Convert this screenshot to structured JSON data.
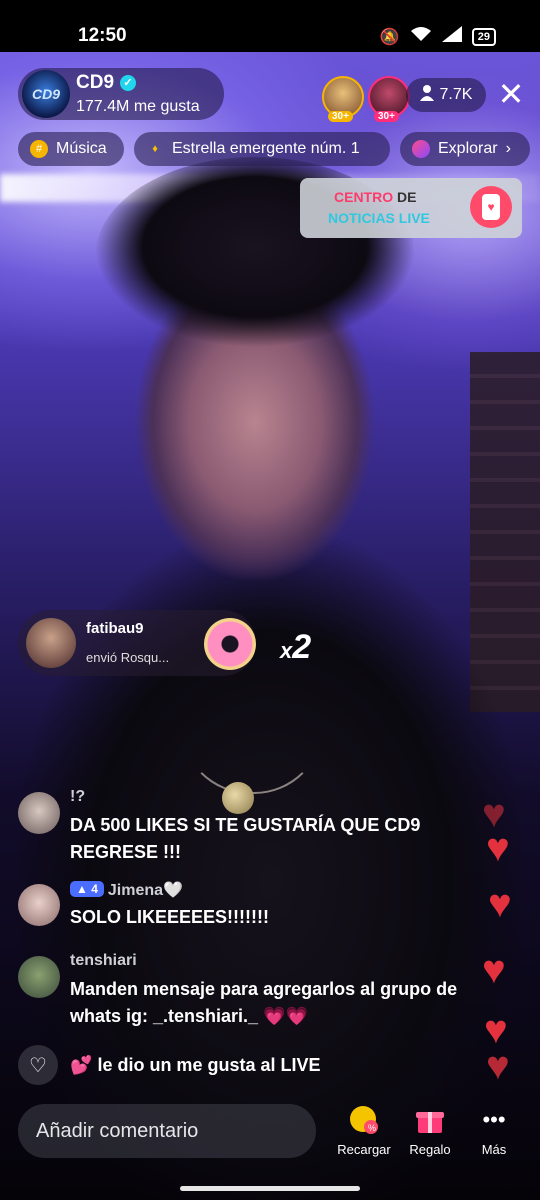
{
  "status_bar": {
    "time": "12:50",
    "battery": "29"
  },
  "host": {
    "name": "CD9",
    "logo_text": "CD9",
    "likes": "177.4M me gusta"
  },
  "top_viewers": [
    {
      "badge": "30+"
    },
    {
      "badge": "30+"
    }
  ],
  "viewer_count": "7.7K",
  "chips": [
    {
      "label": "Música",
      "icon": "music-icon"
    },
    {
      "label": "Estrella emergente núm. 1",
      "icon": "flame-icon"
    },
    {
      "label": "Explorar",
      "icon": "planet-icon"
    }
  ],
  "news_banner": {
    "line1_pink": "CENTRO",
    "line1_rest": " DE",
    "line2": "NOTICIAS LIVE"
  },
  "gift_toast": {
    "username": "fatibau9",
    "text": "envió Rosqu...",
    "multiplier": "x",
    "count": "2"
  },
  "comments": [
    {
      "username": "!?",
      "level": "",
      "text": "DA 500 LIKES SI TE GUSTARÍA QUE CD9 REGRESE !!!"
    },
    {
      "username": "Jimena🤍",
      "level": "4",
      "text": "SOLO LIKEEEEES!!!!!!!"
    },
    {
      "username": "tenshiari",
      "level": "",
      "text": "Manden mensaje para agregarlos al grupo de whats ig: _.tenshiari._ 💗💗"
    }
  ],
  "system_message": {
    "emoji": "💕",
    "text": "le dio un me gusta al LIVE"
  },
  "bottom_bar": {
    "comment_placeholder": "Añadir comentario",
    "recharge_label": "Recargar",
    "gift_label": "Regalo",
    "more_label": "Más"
  },
  "colors": {
    "heart": "#e3323e",
    "verified": "#20d5ec",
    "accent_pink": "#ff3b6b"
  }
}
